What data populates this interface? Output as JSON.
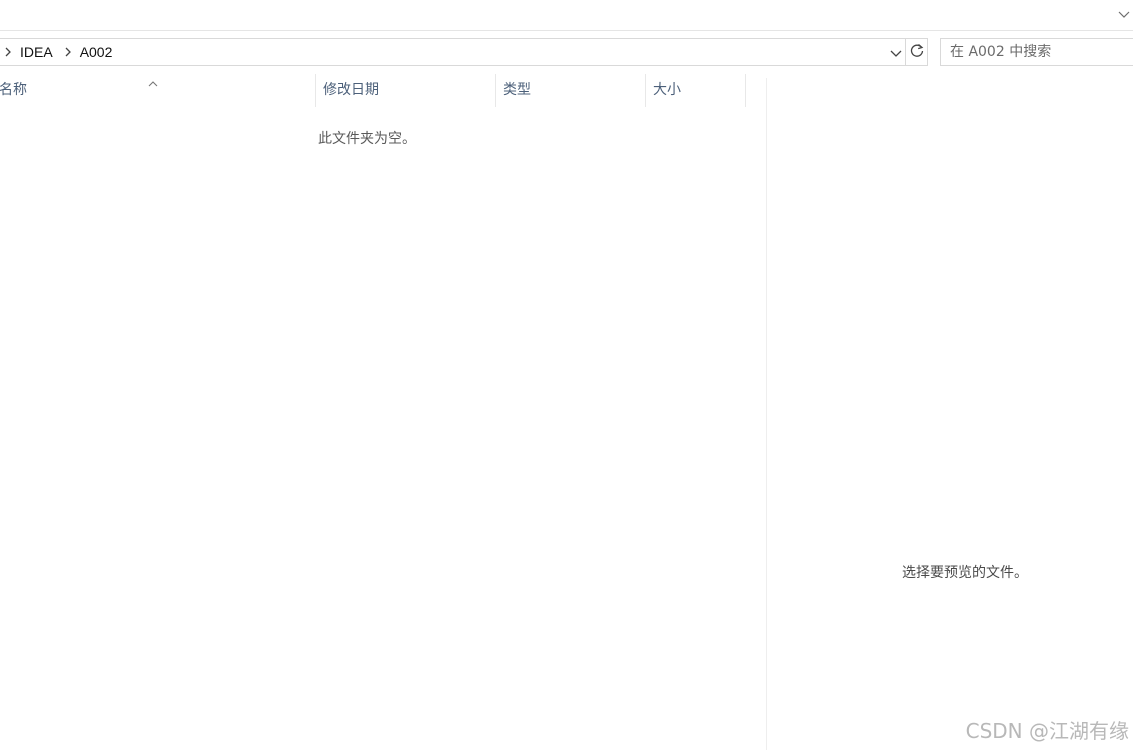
{
  "address": {
    "breadcrumbs": [
      "IDEA",
      "A002"
    ]
  },
  "search": {
    "placeholder": "在 A002 中搜索"
  },
  "file_list": {
    "columns": {
      "name": "名称",
      "modified": "修改日期",
      "type": "类型",
      "size": "大小"
    },
    "empty_message": "此文件夹为空。"
  },
  "preview": {
    "message": "选择要预览的文件。"
  },
  "watermark": "CSDN @江湖有缘",
  "icons": {
    "ribbon_toggle": "chevron-down-icon",
    "breadcrumb_separator": "chevron-right-icon",
    "address_dropdown": "chevron-down-icon",
    "refresh": "refresh-icon",
    "sort": "sort-ascending-icon"
  }
}
